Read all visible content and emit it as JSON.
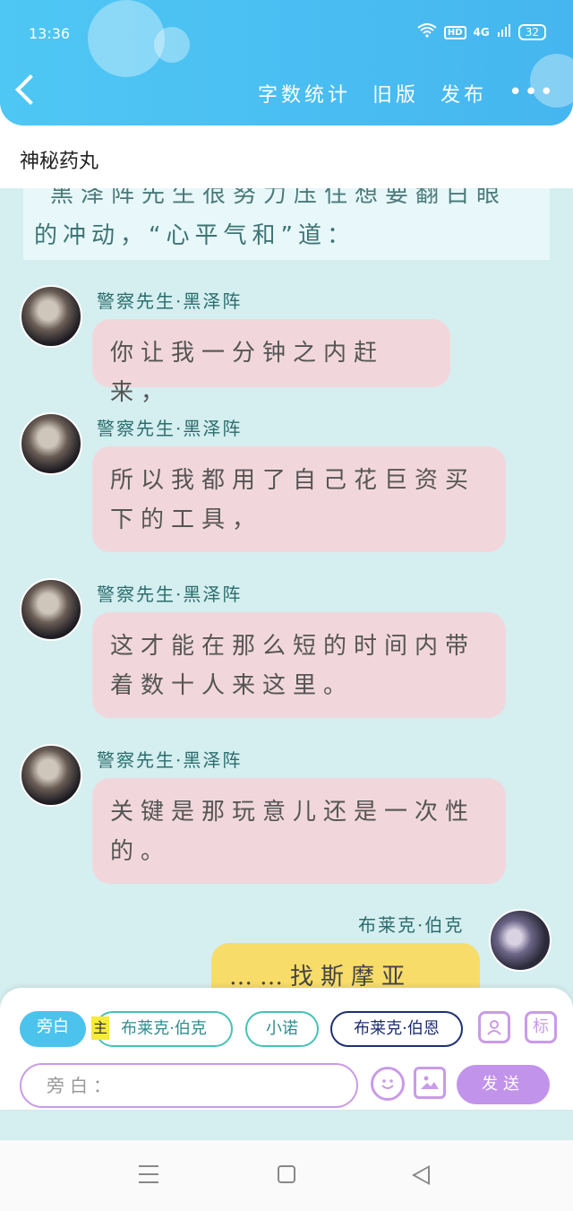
{
  "status": {
    "time": "13:36",
    "hd": "HD",
    "network": "4G",
    "battery": "32"
  },
  "nav": {
    "word_count": "字数统计",
    "old_version": "旧版",
    "publish": "发布",
    "more": "•••"
  },
  "title": "神秘药丸",
  "narration": {
    "cut_line": "黑泽阵先生很努力压住想要翻白眼",
    "line": "的冲动，“心平气和”道："
  },
  "messages": [
    {
      "speaker": "警察先生·黑泽阵",
      "text": "你让我一分钟之内赶来，"
    },
    {
      "speaker": "警察先生·黑泽阵",
      "text": "所以我都用了自己花巨资买下的工具，"
    },
    {
      "speaker": "警察先生·黑泽阵",
      "text": "这才能在那么短的时间内带着数十人来这里。"
    },
    {
      "speaker": "警察先生·黑泽阵",
      "text": "关键是那玩意儿还是一次性的。"
    },
    {
      "speaker": "布莱克·伯克",
      "text": "……找斯摩亚蒂。"
    }
  ],
  "panel": {
    "narrator_chip": "旁白",
    "main_badge": "主",
    "chips": [
      "布莱克·伯克",
      "小诺",
      "布莱克·伯恩"
    ],
    "contact_icon": "contact-card-icon",
    "mark_button": "标",
    "input_placeholder": "旁白：",
    "emoji_icon": "smiley-icon",
    "image_icon": "image-icon",
    "send": "发送"
  },
  "colors": {
    "header": "#45b6ef",
    "chat_bg": "#d5eef0",
    "bubble_pink": "#f1d7db",
    "bubble_yellow": "#f7dc6a",
    "accent_purple": "#c293ea"
  }
}
